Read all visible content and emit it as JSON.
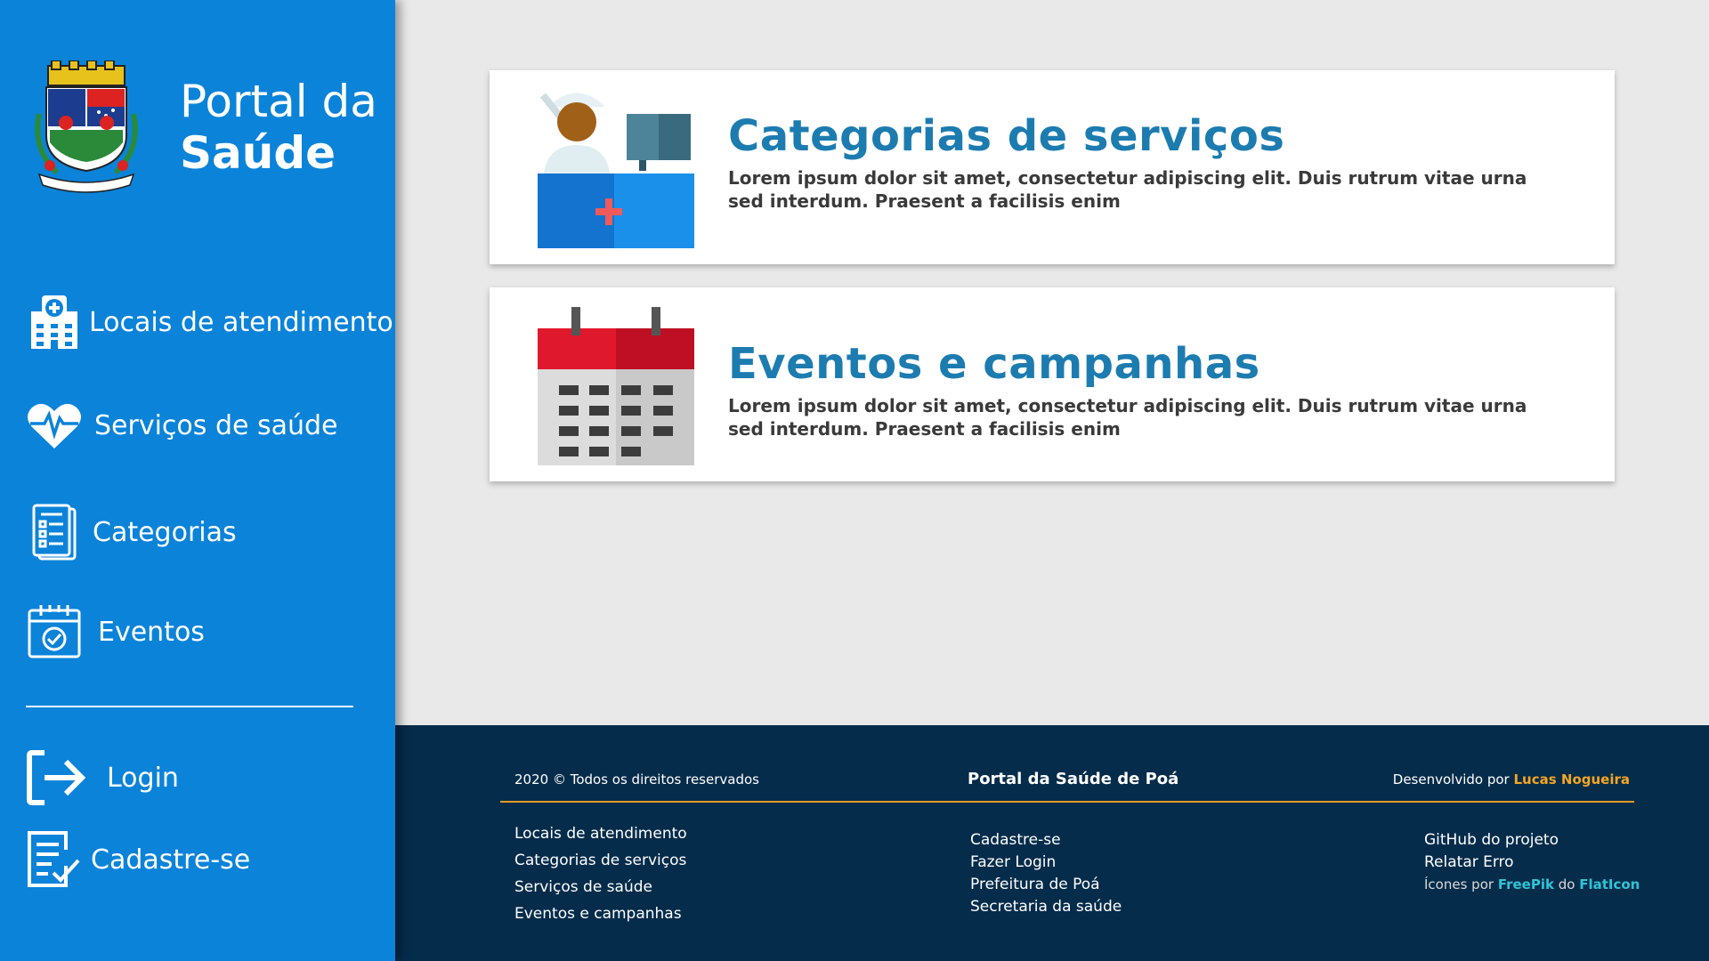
{
  "brand": {
    "line1": "Portal da",
    "line2": "Saúde"
  },
  "sidebar": {
    "items": [
      {
        "label": "Locais de atendimento",
        "icon": "hospital-icon"
      },
      {
        "label": "Serviços de saúde",
        "icon": "heart-pulse-icon"
      },
      {
        "label": "Categorias",
        "icon": "document-list-icon"
      },
      {
        "label": "Eventos",
        "icon": "calendar-check-icon"
      }
    ],
    "auth": [
      {
        "label": "Login",
        "icon": "login-arrow-icon"
      },
      {
        "label": "Cadastre-se",
        "icon": "form-check-icon"
      }
    ]
  },
  "cards": [
    {
      "title": "Categorias de serviços",
      "description": "Lorem ipsum dolor sit amet, consectetur adipiscing elit. Duis rutrum vitae urna sed interdum. Praesent a facilisis enim",
      "icon": "nurse-desk-icon"
    },
    {
      "title": "Eventos e campanhas",
      "description": "Lorem ipsum dolor sit amet, consectetur adipiscing elit. Duis rutrum vitae urna sed interdum. Praesent a facilisis enim",
      "icon": "calendar-icon"
    }
  ],
  "footer": {
    "copyright": "2020 © Todos os direitos reservados",
    "center_title": "Portal da Saúde de Poá",
    "dev_prefix": "Desenvolvido por ",
    "dev_name": "Lucas Nogueira",
    "col1": [
      "Locais de atendimento",
      "Categorias de serviços",
      "Serviços de saúde",
      "Eventos e campanhas"
    ],
    "col2": [
      "Cadastre-se",
      "Fazer Login",
      "Prefeitura de Poá",
      "Secretaria da saúde"
    ],
    "col3": [
      "GitHub do projeto",
      "Relatar Erro"
    ],
    "credit": {
      "prefix": "Ícones por ",
      "freepik": "FreePik",
      "middle": " do ",
      "flaticon": "FlatIcon"
    }
  },
  "colors": {
    "sidebar": "#0b83d9",
    "footer": "#062c4b",
    "accent": "#e29a22",
    "title": "#1c7cb0"
  }
}
